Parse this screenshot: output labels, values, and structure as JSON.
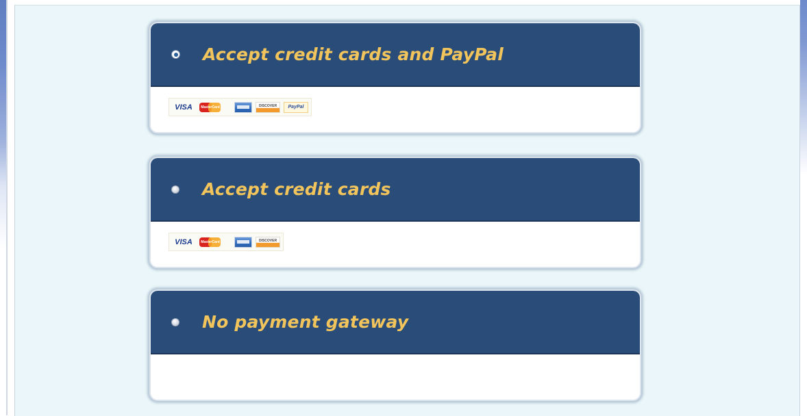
{
  "options": [
    {
      "label": "Accept credit cards and PayPal",
      "selected": true,
      "cards": [
        "VISA",
        "MasterCard",
        "American Express",
        "DISCOVER",
        "PayPal"
      ]
    },
    {
      "label": "Accept credit cards",
      "selected": false,
      "cards": [
        "VISA",
        "MasterCard",
        "American Express",
        "DISCOVER"
      ]
    },
    {
      "label": "No payment gateway",
      "selected": false,
      "cards": []
    }
  ],
  "card_text": {
    "visa": "VISA",
    "mastercard": "MasterCard",
    "discover": "DISCOVER",
    "paypal": "PayPal"
  },
  "colors": {
    "header_bg": "#2a4c79",
    "label": "#f2c45c",
    "panel_bg": "#eaf6f9"
  }
}
